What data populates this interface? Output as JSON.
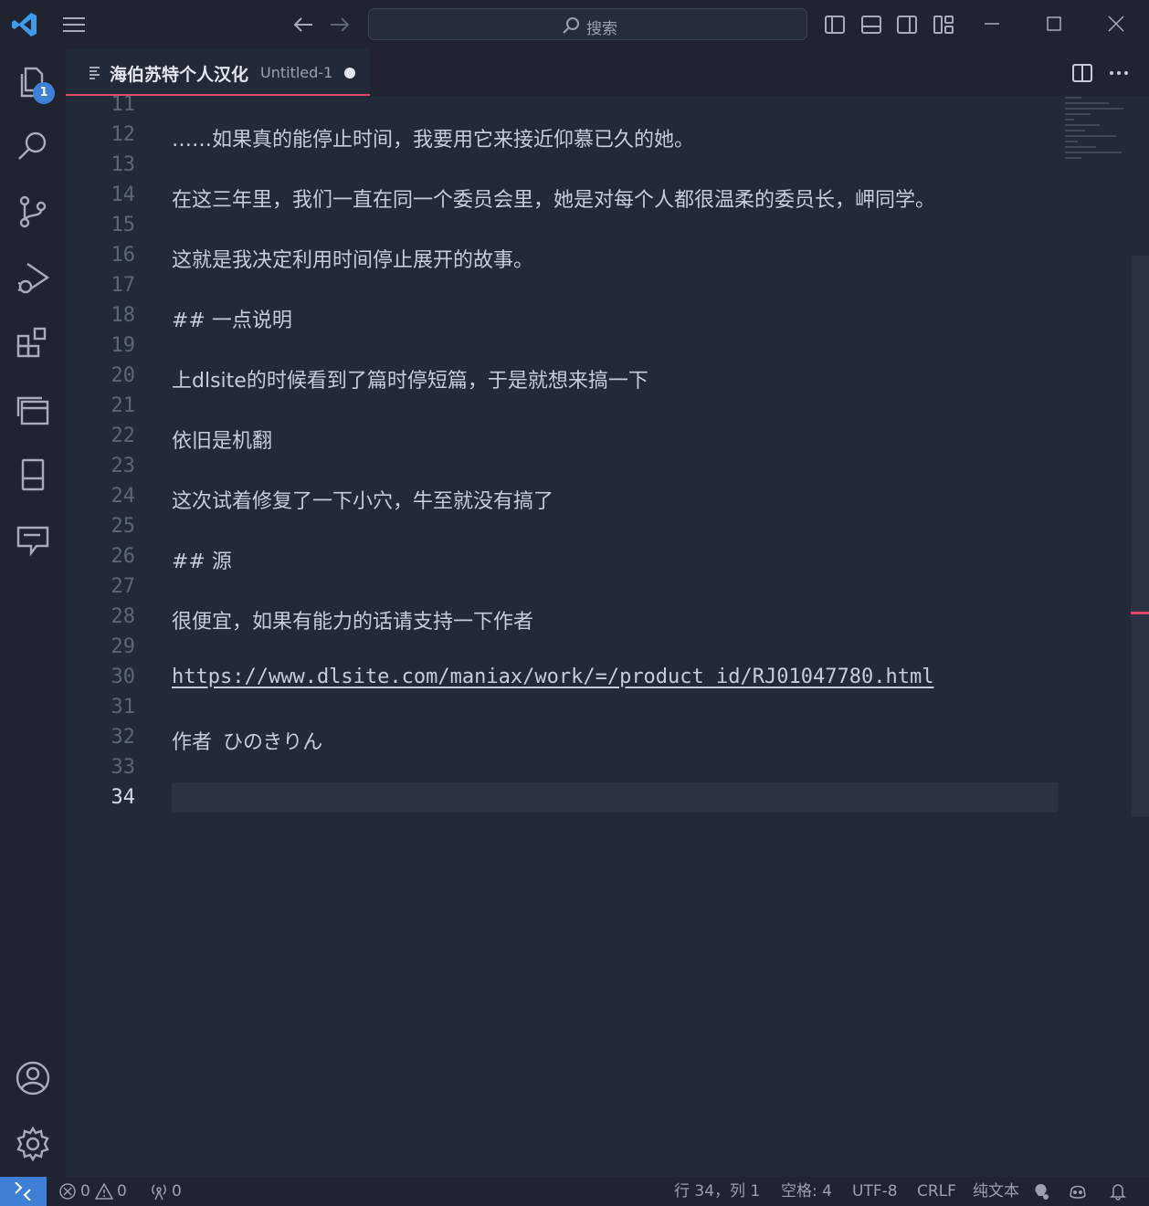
{
  "titlebar": {
    "search_placeholder": "搜索"
  },
  "activity": {
    "explorer_badge": "1"
  },
  "tab": {
    "name": "海伯苏特个人汉化",
    "description": "Untitled-1"
  },
  "editor": {
    "lines": [
      {
        "num": "11",
        "text": ""
      },
      {
        "num": "12",
        "text": "……如果真的能停止时间，我要用它来接近仰慕已久的她。"
      },
      {
        "num": "13",
        "text": ""
      },
      {
        "num": "14",
        "text": "在这三年里，我们一直在同一个委员会里，她是对每个人都很温柔的委员长，岬同学。"
      },
      {
        "num": "15",
        "text": ""
      },
      {
        "num": "16",
        "text": "这就是我决定利用时间停止展开的故事。"
      },
      {
        "num": "17",
        "text": ""
      },
      {
        "num": "18",
        "text": "## 一点说明"
      },
      {
        "num": "19",
        "text": ""
      },
      {
        "num": "20",
        "text": "上dlsite的时候看到了篇时停短篇，于是就想来搞一下"
      },
      {
        "num": "21",
        "text": ""
      },
      {
        "num": "22",
        "text": "依旧是机翻"
      },
      {
        "num": "23",
        "text": ""
      },
      {
        "num": "24",
        "text": "这次试着修复了一下小穴，牛至就没有搞了"
      },
      {
        "num": "25",
        "text": ""
      },
      {
        "num": "26",
        "text": "## 源"
      },
      {
        "num": "27",
        "text": ""
      },
      {
        "num": "28",
        "text": "很便宜，如果有能力的话请支持一下作者"
      },
      {
        "num": "29",
        "text": ""
      },
      {
        "num": "30",
        "text": "https://www.dlsite.com/maniax/work/=/product_id/RJ01047780.html"
      },
      {
        "num": "31",
        "text": ""
      },
      {
        "num": "32",
        "text": "作者\tひのきりん"
      },
      {
        "num": "33",
        "text": ""
      },
      {
        "num": "34",
        "text": ""
      }
    ],
    "current_line": "34"
  },
  "statusbar": {
    "errors": "0",
    "warnings": "0",
    "ports": "0",
    "position": "行 34，列 1",
    "indent": "空格: 4",
    "encoding": "UTF-8",
    "eol": "CRLF",
    "language": "纯文本"
  },
  "colors": {
    "accent": "#3f7fd6",
    "tab_underline": "#e0496b",
    "background": "#232a37",
    "chrome": "#1f2430"
  }
}
